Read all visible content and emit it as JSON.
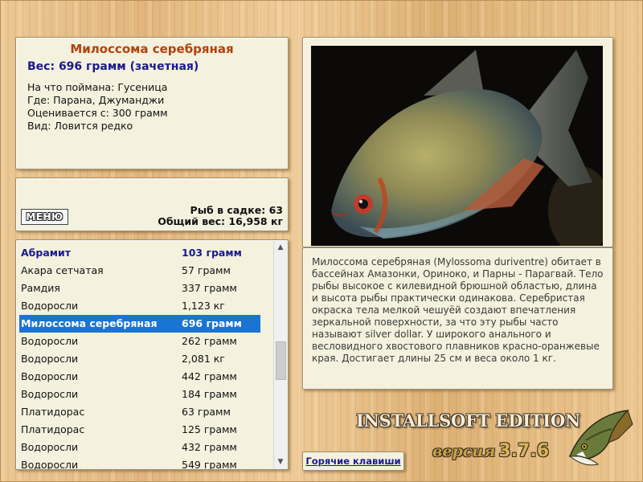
{
  "info": {
    "fish_name": "Милоссома серебряная",
    "weight_text": "Вес: 696 грамм (зачетная)",
    "caught_on": "На что поймана: Гусеница",
    "where": "Где: Парана, Джуманджи",
    "rated_from": "Оценивается с: 300 грамм",
    "kind": "Вид: Ловится редко"
  },
  "stats": {
    "menu_label": "МЕНЮ",
    "fish_in_keepnet": "Рыб в садке: 63",
    "total_weight": "Общий вес: 16,958 кг"
  },
  "list": {
    "rows": [
      {
        "name": "Абрамит",
        "weight": "103 грамм",
        "style": "bold"
      },
      {
        "name": "Акара сетчатая",
        "weight": "57 грамм",
        "style": ""
      },
      {
        "name": "Рамдия",
        "weight": "337 грамм",
        "style": ""
      },
      {
        "name": "Водоросли",
        "weight": "1,123 кг",
        "style": ""
      },
      {
        "name": "Милоссома серебряная",
        "weight": "696 грамм",
        "style": "sel"
      },
      {
        "name": "Водоросли",
        "weight": "262 грамм",
        "style": ""
      },
      {
        "name": "Водоросли",
        "weight": "2,081 кг",
        "style": ""
      },
      {
        "name": "Водоросли",
        "weight": "442 грамм",
        "style": ""
      },
      {
        "name": "Водоросли",
        "weight": "184 грамм",
        "style": ""
      },
      {
        "name": "Платидорас",
        "weight": "63 грамм",
        "style": ""
      },
      {
        "name": "Платидорас",
        "weight": "125 грамм",
        "style": ""
      },
      {
        "name": "Водоросли",
        "weight": "432 грамм",
        "style": ""
      },
      {
        "name": "Водоросли",
        "weight": "549 грамм",
        "style": ""
      }
    ]
  },
  "description": {
    "text": "Милоссома серебряная (Mylossoma duriventre) обитает в бассейнах Амазонки, Ориноко, и Парны - Парагвай. Тело рыбы высокое с килевидной брюшной областью, длина и высота рыбы практически одинакова. Серебристая окраска тела мелкой чешуёй создают впечатления зеркальной поверхности, за что эту рыбы часто называют silver dollar. У широкого анального и весловидного хвостового плавников красно-оранжевые края. Достигает длины 25 см и веса около 1 кг."
  },
  "hotkeys": {
    "label": "Горячие клавиши"
  },
  "brand": {
    "edition": "INSTALLSOFT EDITION",
    "version_label": "версия",
    "version_number": "3.7.6"
  },
  "colors": {
    "accent_title": "#b2410d",
    "accent_blue": "#1a1a8c",
    "selection": "#1a74d4",
    "panel_bg": "#f4f1de"
  }
}
